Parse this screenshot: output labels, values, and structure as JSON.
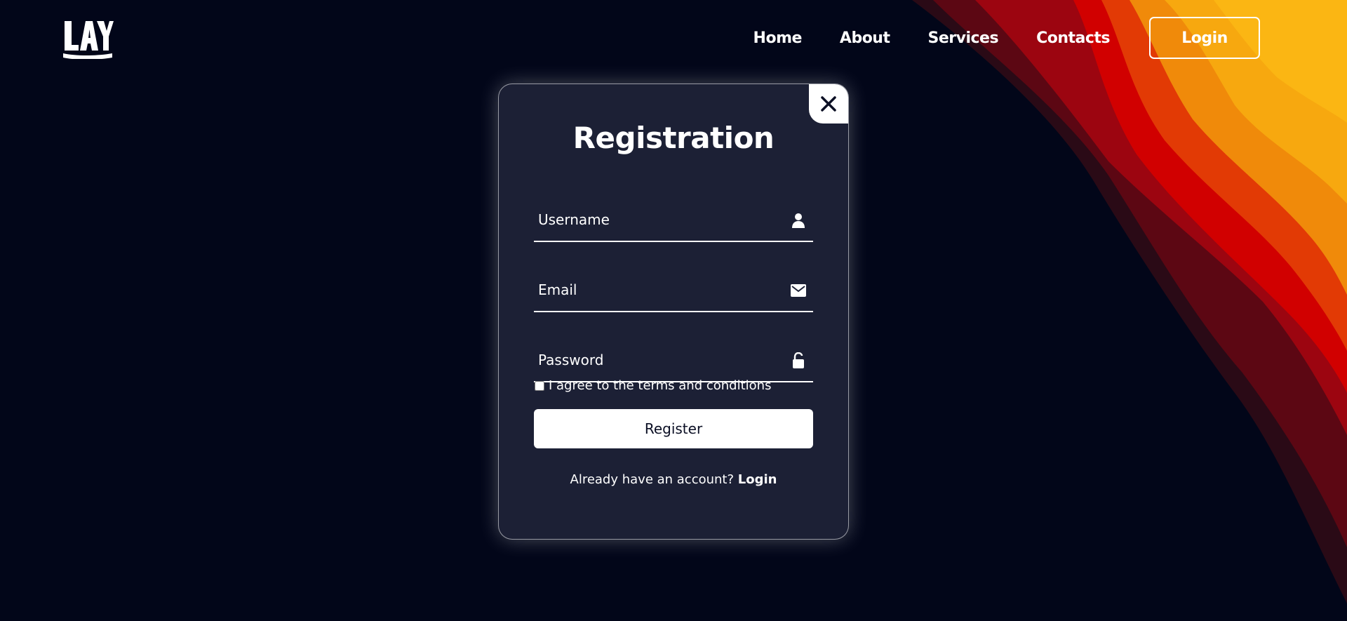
{
  "header": {
    "logo": "logo-icon",
    "nav": [
      {
        "label": "Home"
      },
      {
        "label": "About"
      },
      {
        "label": "Services"
      },
      {
        "label": "Contacts"
      }
    ],
    "login_label": "Login"
  },
  "modal": {
    "title": "Registration",
    "close_icon": "close-icon",
    "fields": {
      "username": {
        "placeholder": "Username",
        "value": "",
        "icon": "user-icon"
      },
      "email": {
        "placeholder": "Email",
        "value": "",
        "icon": "mail-icon"
      },
      "password": {
        "placeholder": "Password",
        "value": "",
        "icon": "lock-icon"
      }
    },
    "terms_label": "I agree to the terms and conditions",
    "terms_checked": false,
    "register_label": "Register",
    "switch_text": "Already have an account?",
    "switch_link": "Login"
  },
  "colors": {
    "background": "#020619",
    "modal_bg": "#1c2035",
    "wave_dark": "#5c0713",
    "wave_red": "#d10000",
    "wave_orange": "#f08a0a",
    "wave_yellow": "#fbb613"
  }
}
